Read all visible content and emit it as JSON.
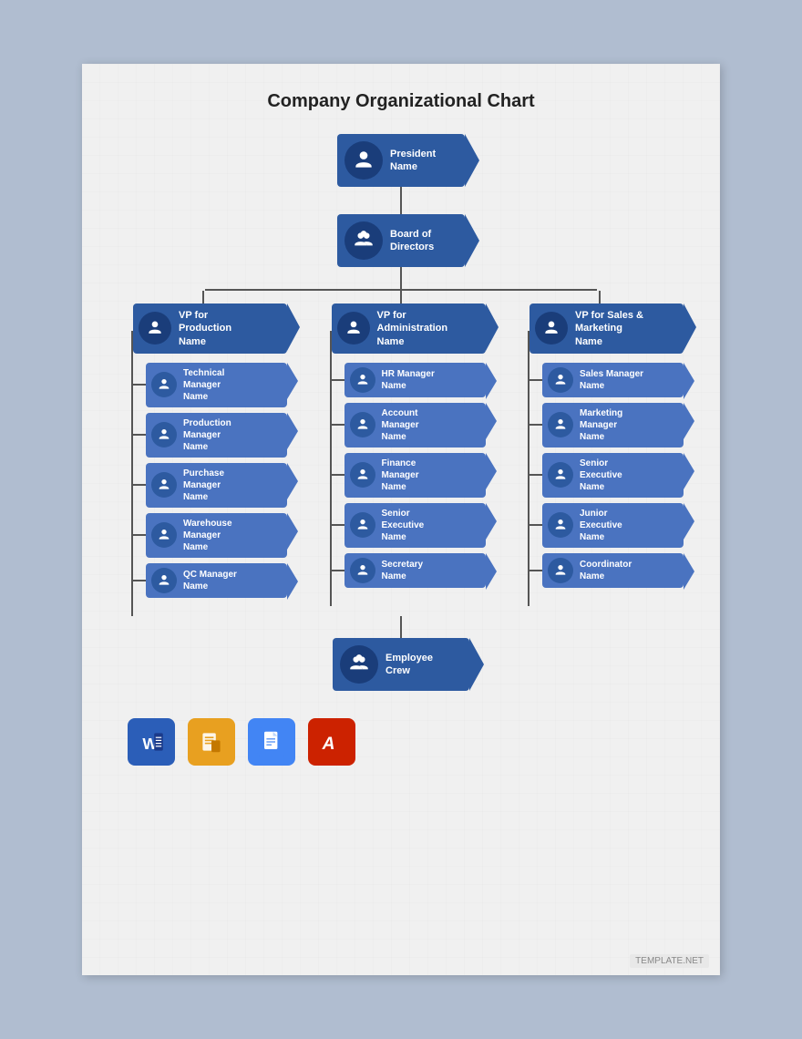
{
  "page": {
    "title": "Company Organizational Chart",
    "background_color": "#b0bdd0",
    "paper_color": "#f0f0f0"
  },
  "chart": {
    "title": "Company Organizational Chart",
    "colors": {
      "primary": "#2d5aa0",
      "secondary": "#4a73c0",
      "dark": "#1a3d7a",
      "line": "#555555"
    },
    "president": {
      "title": "President",
      "name": "Name"
    },
    "board": {
      "title": "Board of",
      "title2": "Directors"
    },
    "vps": [
      {
        "title": "VP for",
        "title2": "Production",
        "name": "Name",
        "reports": [
          {
            "title": "Technical",
            "title2": "Manager",
            "name": "Name"
          },
          {
            "title": "Production",
            "title2": "Manager",
            "name": "Name"
          },
          {
            "title": "Purchase",
            "title2": "Manager",
            "name": "Name"
          },
          {
            "title": "Warehouse",
            "title2": "Manager",
            "name": "Name"
          },
          {
            "title": "QC Manager",
            "title2": "",
            "name": "Name"
          }
        ]
      },
      {
        "title": "VP for",
        "title2": "Administration",
        "name": "Name",
        "reports": [
          {
            "title": "HR Manager",
            "title2": "",
            "name": "Name"
          },
          {
            "title": "Account",
            "title2": "Manager",
            "name": "Name"
          },
          {
            "title": "Finance",
            "title2": "Manager",
            "name": "Name"
          },
          {
            "title": "Senior",
            "title2": "Executive",
            "name": "Name"
          },
          {
            "title": "Secretary",
            "title2": "",
            "name": "Name"
          }
        ]
      },
      {
        "title": "VP for Sales &",
        "title2": "Marketing",
        "name": "Name",
        "reports": [
          {
            "title": "Sales Manager",
            "title2": "",
            "name": "Name"
          },
          {
            "title": "Marketing",
            "title2": "Manager",
            "name": "Name"
          },
          {
            "title": "Senior",
            "title2": "Executive",
            "name": "Name"
          },
          {
            "title": "Junior",
            "title2": "Executive",
            "name": "Name"
          },
          {
            "title": "Coordinator",
            "title2": "",
            "name": "Name"
          }
        ]
      }
    ],
    "employee": {
      "title": "Employee",
      "title2": "Crew"
    }
  },
  "toolbar": {
    "items": [
      {
        "name": "Microsoft Word",
        "type": "word",
        "label": "W"
      },
      {
        "name": "Apple Pages",
        "type": "pages",
        "label": "P"
      },
      {
        "name": "Google Docs",
        "type": "docs",
        "label": "D"
      },
      {
        "name": "Adobe Acrobat",
        "type": "acrobat",
        "label": "A"
      }
    ]
  },
  "watermark": {
    "text": "TEMPLATE.NET"
  }
}
